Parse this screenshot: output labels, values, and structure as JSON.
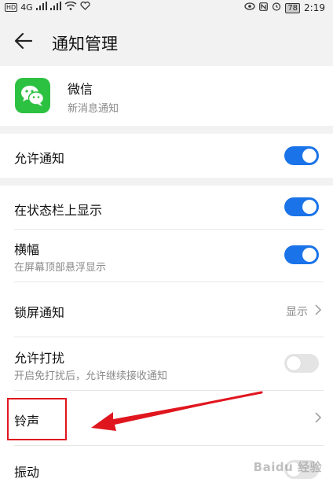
{
  "statusbar": {
    "hd": "HD",
    "network": "4G",
    "battery": "78",
    "time": "2:19"
  },
  "header": {
    "title": "通知管理"
  },
  "app": {
    "name": "微信",
    "subtitle": "新消息通知",
    "brand_color": "#2dc142"
  },
  "settings": {
    "allow_notifications": {
      "label": "允许通知",
      "enabled": true
    },
    "status_bar": {
      "label": "在状态栏上显示",
      "enabled": true
    },
    "banner": {
      "label": "横幅",
      "sub": "在屏幕顶部悬浮显示",
      "enabled": true
    },
    "lock_screen": {
      "label": "锁屏通知",
      "value": "显示"
    },
    "dnd": {
      "label": "允许打扰",
      "sub": "开启免打扰后，允许继续接收通知",
      "enabled": false
    },
    "ringtone": {
      "label": "铃声"
    },
    "vibration": {
      "label": "振动",
      "enabled": false
    }
  },
  "colors": {
    "accent": "#1a73e8",
    "annotation": "#e0161f"
  },
  "watermark": "Baidu 经验"
}
